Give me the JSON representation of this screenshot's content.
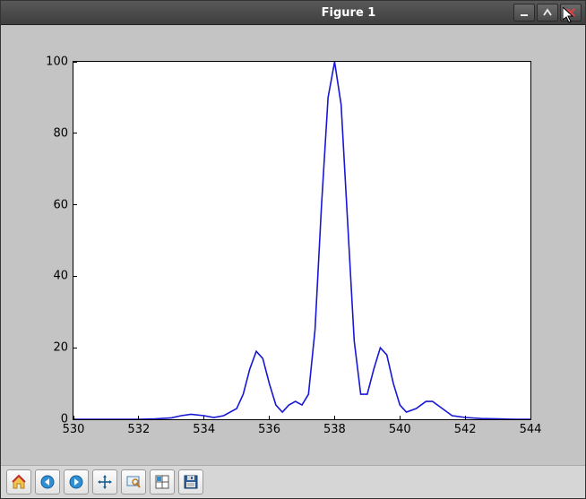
{
  "window": {
    "title": "Figure 1",
    "controls": {
      "minimize": "minimize-button",
      "maximize": "maximize-button",
      "close": "close-button"
    }
  },
  "toolbar": {
    "buttons": [
      {
        "name": "home-button",
        "icon": "home-icon"
      },
      {
        "name": "back-button",
        "icon": "arrow-left-icon"
      },
      {
        "name": "forward-button",
        "icon": "arrow-right-icon"
      },
      {
        "name": "pan-button",
        "icon": "move-icon"
      },
      {
        "name": "zoom-button",
        "icon": "zoom-rect-icon"
      },
      {
        "name": "subplots-button",
        "icon": "subplots-icon"
      },
      {
        "name": "save-button",
        "icon": "save-icon"
      }
    ]
  },
  "chart_data": {
    "type": "line",
    "xlabel": "",
    "ylabel": "",
    "title": "",
    "xlim": [
      530,
      544
    ],
    "ylim": [
      0,
      100
    ],
    "xticks": [
      530,
      532,
      534,
      536,
      538,
      540,
      542,
      544
    ],
    "yticks": [
      0,
      20,
      40,
      60,
      80,
      100
    ],
    "series": [
      {
        "name": "series-1",
        "color": "#1818d4",
        "x": [
          530.0,
          530.5,
          531.0,
          531.5,
          532.0,
          532.5,
          533.0,
          533.3,
          533.6,
          534.0,
          534.3,
          534.6,
          535.0,
          535.2,
          535.4,
          535.6,
          535.8,
          536.0,
          536.2,
          536.4,
          536.6,
          536.8,
          537.0,
          537.2,
          537.4,
          537.6,
          537.8,
          538.0,
          538.2,
          538.4,
          538.6,
          538.8,
          539.0,
          539.2,
          539.4,
          539.6,
          539.8,
          540.0,
          540.2,
          540.5,
          540.8,
          541.0,
          541.3,
          541.6,
          542.0,
          542.5,
          543.0,
          543.5,
          544.0
        ],
        "y": [
          0.0,
          0.0,
          0.0,
          0.0,
          0.0,
          0.1,
          0.4,
          1.0,
          1.4,
          1.0,
          0.5,
          1.0,
          3.0,
          7.0,
          14.0,
          19.0,
          17.0,
          10.0,
          4.0,
          2.0,
          4.0,
          5.0,
          4.0,
          7.0,
          25.0,
          60.0,
          90.0,
          100.0,
          88.0,
          55.0,
          22.0,
          7.0,
          7.0,
          14.0,
          20.0,
          18.0,
          10.0,
          4.0,
          2.0,
          3.0,
          5.0,
          5.0,
          3.0,
          1.0,
          0.5,
          0.2,
          0.1,
          0.0,
          0.0
        ]
      }
    ]
  }
}
